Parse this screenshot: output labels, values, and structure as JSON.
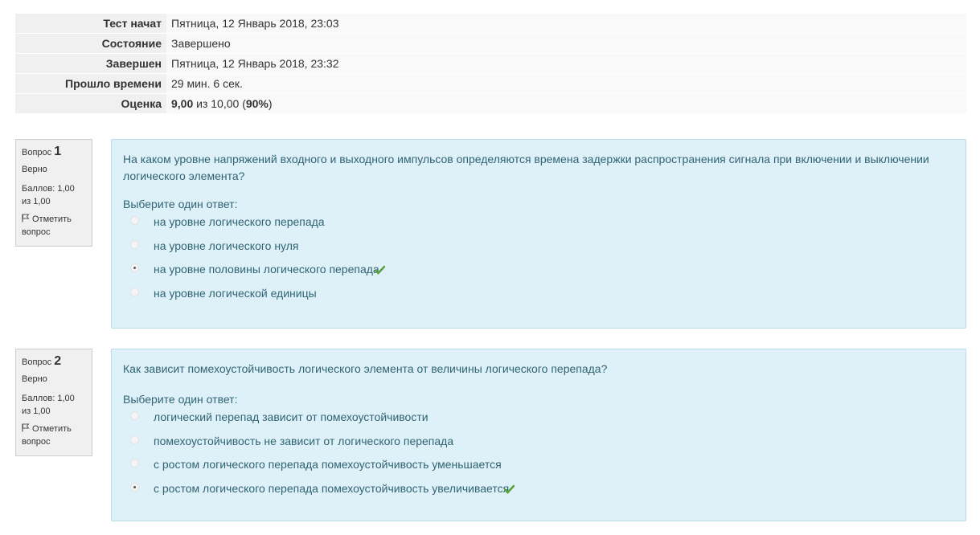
{
  "summary": {
    "rows": [
      {
        "label": "Тест начат",
        "value": "Пятница, 12 Январь 2018, 23:03"
      },
      {
        "label": "Состояние",
        "value": "Завершено"
      },
      {
        "label": "Завершен",
        "value": "Пятница, 12 Январь 2018, 23:32"
      },
      {
        "label": "Прошло времени",
        "value": "29 мин. 6 сек."
      }
    ],
    "grade": {
      "label": "Оценка",
      "score": "9,00",
      "of": " из 10,00 (",
      "percent": "90%",
      "close": ")"
    }
  },
  "questions": [
    {
      "prefix": "Вопрос ",
      "number": "1",
      "state": "Верно",
      "grade": "Баллов: 1,00 из 1,00",
      "flag_label": "Отметить вопрос",
      "text": "На каком уровне напряжений входного и выходного импульсов определяются времена задержки распространения сигнала при включении и выключении логического элемента?",
      "prompt": "Выберите один ответ:",
      "answers": [
        {
          "label": "на уровне логического перепада",
          "checked": false,
          "correct": false
        },
        {
          "label": "на уровне логического нуля",
          "checked": false,
          "correct": false
        },
        {
          "label": "на уровне половины логического перепада",
          "checked": true,
          "correct": true
        },
        {
          "label": "на уровне логической единицы",
          "checked": false,
          "correct": false
        }
      ]
    },
    {
      "prefix": "Вопрос ",
      "number": "2",
      "state": "Верно",
      "grade": "Баллов: 1,00 из 1,00",
      "flag_label": "Отметить вопрос",
      "text": "Как зависит помехоустойчивость логического элемента от величины логического перепада?",
      "prompt": "Выберите один ответ:",
      "answers": [
        {
          "label": "логический перепад зависит от помехоустойчивости",
          "checked": false,
          "correct": false
        },
        {
          "label": "помехоустойчивость не зависит от логического перепада",
          "checked": false,
          "correct": false
        },
        {
          "label": "с ростом логического перепада помехоустойчивость уменьшается",
          "checked": false,
          "correct": false
        },
        {
          "label": "с ростом логического перепада помехоустойчивость увеличивается",
          "checked": true,
          "correct": true
        }
      ]
    }
  ],
  "icons": {
    "flag": "flag-icon",
    "correct": "check-icon",
    "check_color": "#5aa33c"
  }
}
